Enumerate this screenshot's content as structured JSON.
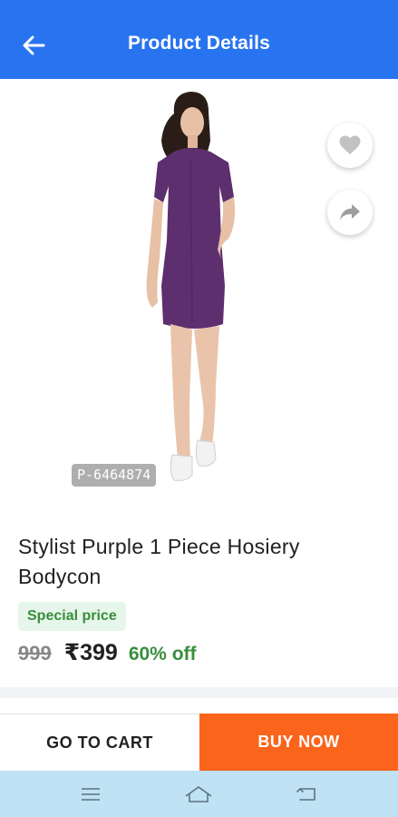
{
  "header": {
    "title": "Product Details",
    "back_icon": "arrow-left-icon",
    "background": "#2874f0"
  },
  "product": {
    "image_alt": "Purple bodycon dress worn by model",
    "product_id": "P-6464874",
    "title": "Stylist Purple 1 Piece Hosiery Bodycon",
    "special_tag": "Special price",
    "mrp": "999",
    "price": "₹399",
    "discount": "60% off",
    "dress_color": "#5d2f6e"
  },
  "floating_actions": {
    "wishlist_icon": "heart-icon",
    "share_icon": "share-icon"
  },
  "actions": {
    "cart_label": "GO TO CART",
    "buy_label": "BUY NOW",
    "buy_color": "#fb641b"
  },
  "system_nav": {
    "menu_icon": "menu-icon",
    "home_icon": "home-icon",
    "back_icon": "back-icon"
  }
}
